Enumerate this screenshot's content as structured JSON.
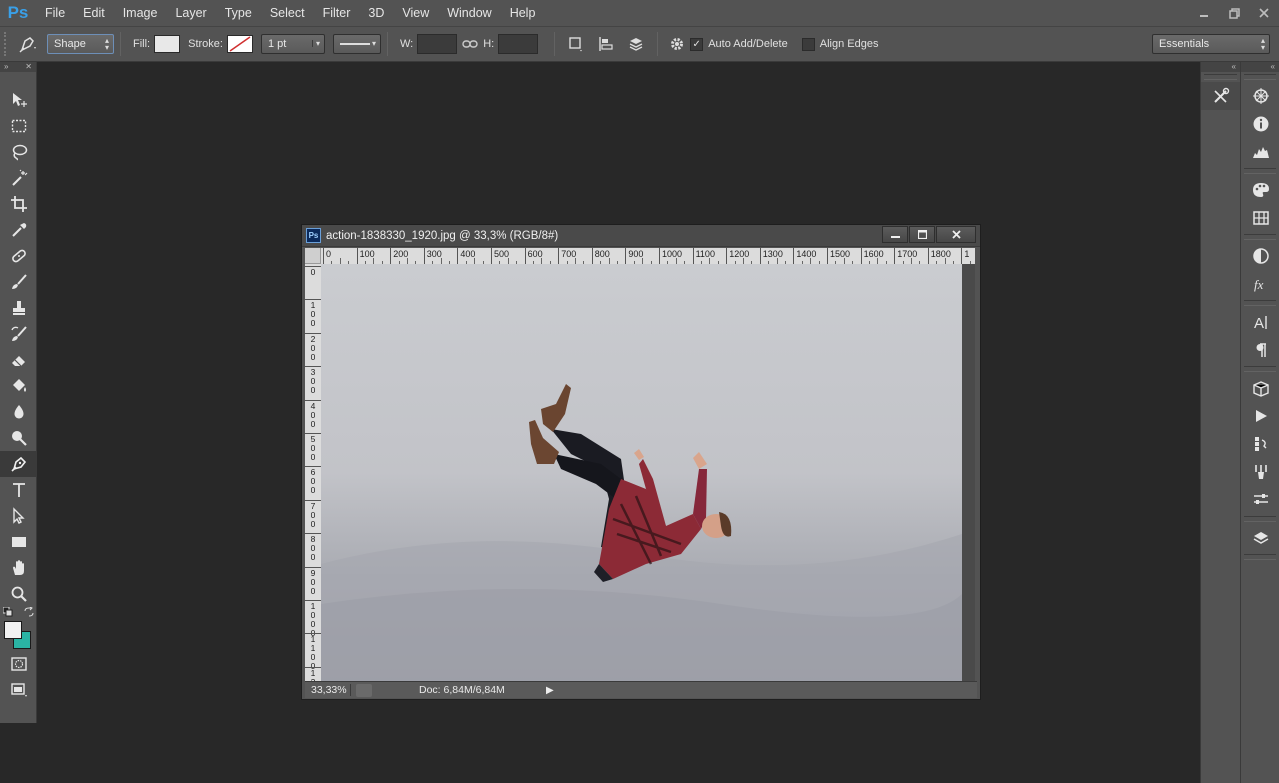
{
  "app": {
    "logo": "Ps"
  },
  "menu": [
    "File",
    "Edit",
    "Image",
    "Layer",
    "Type",
    "Select",
    "Filter",
    "3D",
    "View",
    "Window",
    "Help"
  ],
  "window_controls": {
    "minimize": "—",
    "restore": "❐",
    "close": "✕"
  },
  "options": {
    "tool_mode": "Shape",
    "fill_label": "Fill:",
    "stroke_label": "Stroke:",
    "stroke_width": "1 pt",
    "width_label": "W:",
    "height_label": "H:",
    "auto_add_delete": "Auto Add/Delete",
    "auto_add_delete_checked": true,
    "align_edges": "Align Edges",
    "align_edges_checked": false,
    "workspace": "Essentials",
    "fill_color": "#e8e8e8",
    "accent_color": "#3aa0e8"
  },
  "document": {
    "title": "action-1838330_1920.jpg @ 33,3% (RGB/8#)",
    "zoom": "33,33%",
    "doc_info": "Doc: 6,84M/6,84M",
    "ruler_h": [
      "0",
      "100",
      "200",
      "300",
      "400",
      "500",
      "600",
      "700",
      "800",
      "900",
      "1000",
      "1100",
      "1200",
      "1300",
      "1400",
      "1500",
      "1600",
      "1700",
      "1800",
      "1"
    ],
    "ruler_v": [
      "0",
      "1\n0\n0",
      "2\n0\n0",
      "3\n0\n0",
      "4\n0\n0",
      "5\n0\n0",
      "6\n0\n0",
      "7\n0\n0",
      "8\n0\n0",
      "9\n0\n0",
      "1\n0\n0\n0",
      "1\n1\n0\n0",
      "1\n2"
    ]
  },
  "colors": {
    "foreground": "#f2f2f2",
    "background": "#2ab4a4"
  }
}
